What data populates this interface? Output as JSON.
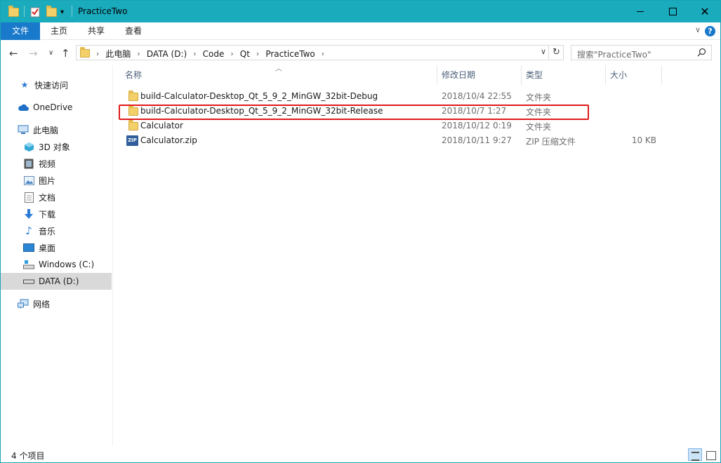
{
  "window": {
    "title": "PracticeTwo",
    "controls": {
      "minimize": "—",
      "maximize": "☐",
      "close": "✕"
    }
  },
  "ribbon": {
    "tabs": [
      "文件",
      "主页",
      "共享",
      "查看"
    ],
    "help": "?"
  },
  "address": {
    "breadcrumbs": [
      "此电脑",
      "DATA (D:)",
      "Code",
      "Qt",
      "PracticeTwo"
    ],
    "search_placeholder": "搜索\"PracticeTwo\""
  },
  "sidebar": {
    "items": [
      {
        "label": "快速访问",
        "icon": "star-icon"
      },
      {
        "label": "OneDrive",
        "icon": "cloud-icon"
      },
      {
        "label": "此电脑",
        "icon": "computer-icon"
      },
      {
        "label": "3D 对象",
        "icon": "cube-icon"
      },
      {
        "label": "视频",
        "icon": "film-icon"
      },
      {
        "label": "图片",
        "icon": "picture-icon"
      },
      {
        "label": "文档",
        "icon": "document-icon"
      },
      {
        "label": "下载",
        "icon": "download-icon"
      },
      {
        "label": "音乐",
        "icon": "music-icon"
      },
      {
        "label": "桌面",
        "icon": "desktop-icon"
      },
      {
        "label": "Windows (C:)",
        "icon": "drive-icon"
      },
      {
        "label": "DATA (D:)",
        "icon": "drive-icon",
        "selected": true
      },
      {
        "label": "网络",
        "icon": "network-icon"
      }
    ]
  },
  "columns": {
    "name": "名称",
    "date": "修改日期",
    "type": "类型",
    "size": "大小"
  },
  "files": [
    {
      "name": "build-Calculator-Desktop_Qt_5_9_2_MinGW_32bit-Debug",
      "date": "2018/10/4 22:55",
      "type": "文件夹",
      "size": "",
      "icon": "folder-icon"
    },
    {
      "name": "build-Calculator-Desktop_Qt_5_9_2_MinGW_32bit-Release",
      "date": "2018/10/7 1:27",
      "type": "文件夹",
      "size": "",
      "icon": "folder-icon",
      "highlighted": true
    },
    {
      "name": "Calculator",
      "date": "2018/10/12 0:19",
      "type": "文件夹",
      "size": "",
      "icon": "folder-icon"
    },
    {
      "name": "Calculator.zip",
      "date": "2018/10/11 9:27",
      "type": "ZIP 压缩文件",
      "size": "10 KB",
      "icon": "zip-icon"
    }
  ],
  "status": {
    "item_count": "4 个项目"
  },
  "colors": {
    "titlebar": "#1aabbc",
    "file_tab": "#1979ca",
    "highlight": "#e01a1a",
    "selected_nav": "#d9d9d9"
  }
}
